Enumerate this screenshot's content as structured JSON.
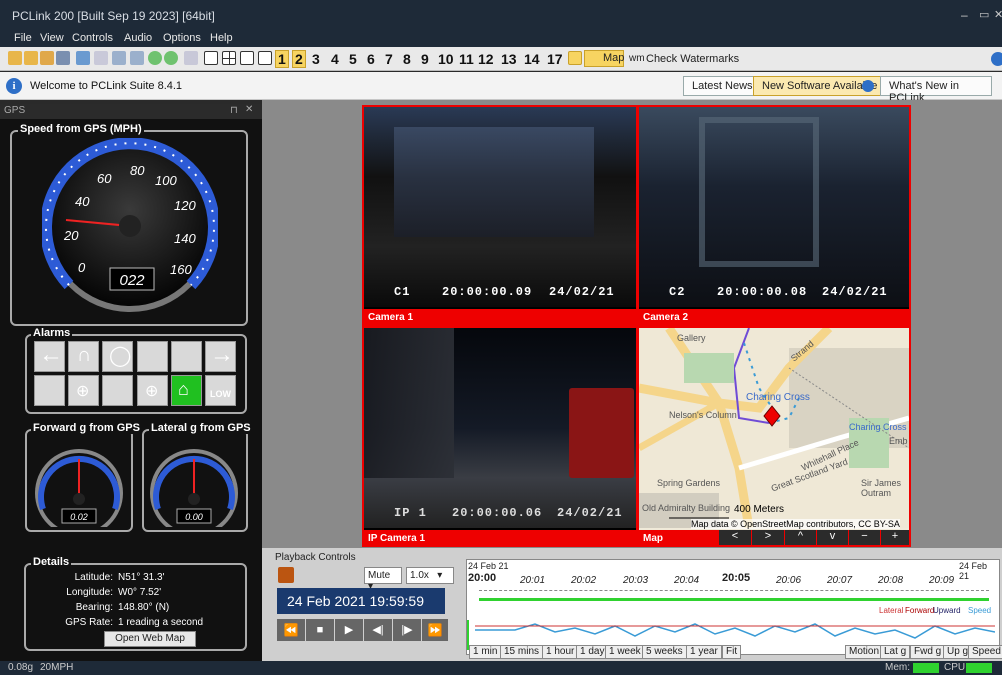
{
  "window": {
    "title": "PCLink 200 [Built Sep 19 2023] [64bit]",
    "min": "–",
    "max": "▭",
    "close": "✕"
  },
  "menu": [
    "File",
    "View",
    "Controls",
    "Audio",
    "Options",
    "Help"
  ],
  "toolbar": {
    "cameras": [
      "1",
      "2",
      "3",
      "4",
      "5",
      "6",
      "7",
      "8",
      "9",
      "10",
      "11",
      "12",
      "13",
      "14",
      "17"
    ],
    "map_label": "Map",
    "wm_label": "wm",
    "watermark_label": "Check Watermarks"
  },
  "welcome": {
    "text": "Welcome to PCLink Suite 8.4.1",
    "latest_news": "Latest News",
    "new_software": "New Software Available",
    "whats_new": "What's New in PCLink"
  },
  "gps": {
    "panel_title": "GPS",
    "speed_title": "Speed from GPS (MPH)",
    "speed_ticks": [
      "0",
      "20",
      "40",
      "60",
      "80",
      "100",
      "120",
      "140",
      "160"
    ],
    "speed_value": "022",
    "alarms_title": "Alarms",
    "forward_title": "Forward g from GPS",
    "lateral_title": "Lateral g from GPS",
    "forward_value": "0.02",
    "lateral_value": "0.00",
    "details_title": "Details",
    "details": [
      {
        "label": "Latitude:",
        "value": "N51° 31.3'"
      },
      {
        "label": "Longitude:",
        "value": "W0° 7.52'"
      },
      {
        "label": "Bearing:",
        "value": "148.80° (N)"
      },
      {
        "label": "GPS Rate:",
        "value": "1 reading a second"
      }
    ],
    "open_map": "Open Web Map"
  },
  "cameras": [
    {
      "label": "Camera 1",
      "id": "C1",
      "time": "20:00:00.09",
      "date": "24/02/21"
    },
    {
      "label": "Camera 2",
      "id": "C2",
      "time": "20:00:00.08",
      "date": "24/02/21"
    },
    {
      "label": "IP Camera 1",
      "id": "IP  1",
      "time": "20:00:00.06",
      "date": "24/02/21"
    },
    {
      "label": "Map",
      "scale": "400 Meters",
      "attribution": "Map data © OpenStreetMap contributors, CC BY-SA"
    }
  ],
  "map_places": [
    "Charing Cross",
    "Nelson's Column",
    "Strand",
    "Spring Gardens",
    "Great Scotland Yard",
    "Old Admiralty Building",
    "Whitehall Place",
    "Sir James Outram",
    "Charing Cross",
    "Emb",
    "Gallery"
  ],
  "playback": {
    "title": "Playback Controls",
    "mute": "Mute",
    "speed": "1.0x",
    "datetime": "24 Feb 2021  19:59:59",
    "timeline_start": "24 Feb 21",
    "timeline_end": "24 Feb 21",
    "times": [
      "20:00",
      "20:01",
      "20:02",
      "20:03",
      "20:04",
      "20:05",
      "20:06",
      "20:07",
      "20:08",
      "20:09"
    ],
    "legend": [
      "Lateral",
      "Forward",
      "Upward",
      "Speed"
    ],
    "range_tabs": [
      "1 min",
      "15 mins",
      "1 hour",
      "1 day",
      "1 week",
      "5 weeks",
      "1 year",
      "Fit"
    ],
    "metric_tabs": [
      "Motion",
      "Lat g",
      "Fwd g",
      "Up g",
      "Speed"
    ]
  },
  "status": {
    "g": "0.08g",
    "speed": "20MPH",
    "mem": "Mem:",
    "cpu": "CPU:"
  },
  "colors": {
    "accent_red": "#e00000",
    "gauge_blue": "#2d5bd6",
    "title_bg": "#1e2a38",
    "datetime_bg": "#1a3a6e"
  }
}
